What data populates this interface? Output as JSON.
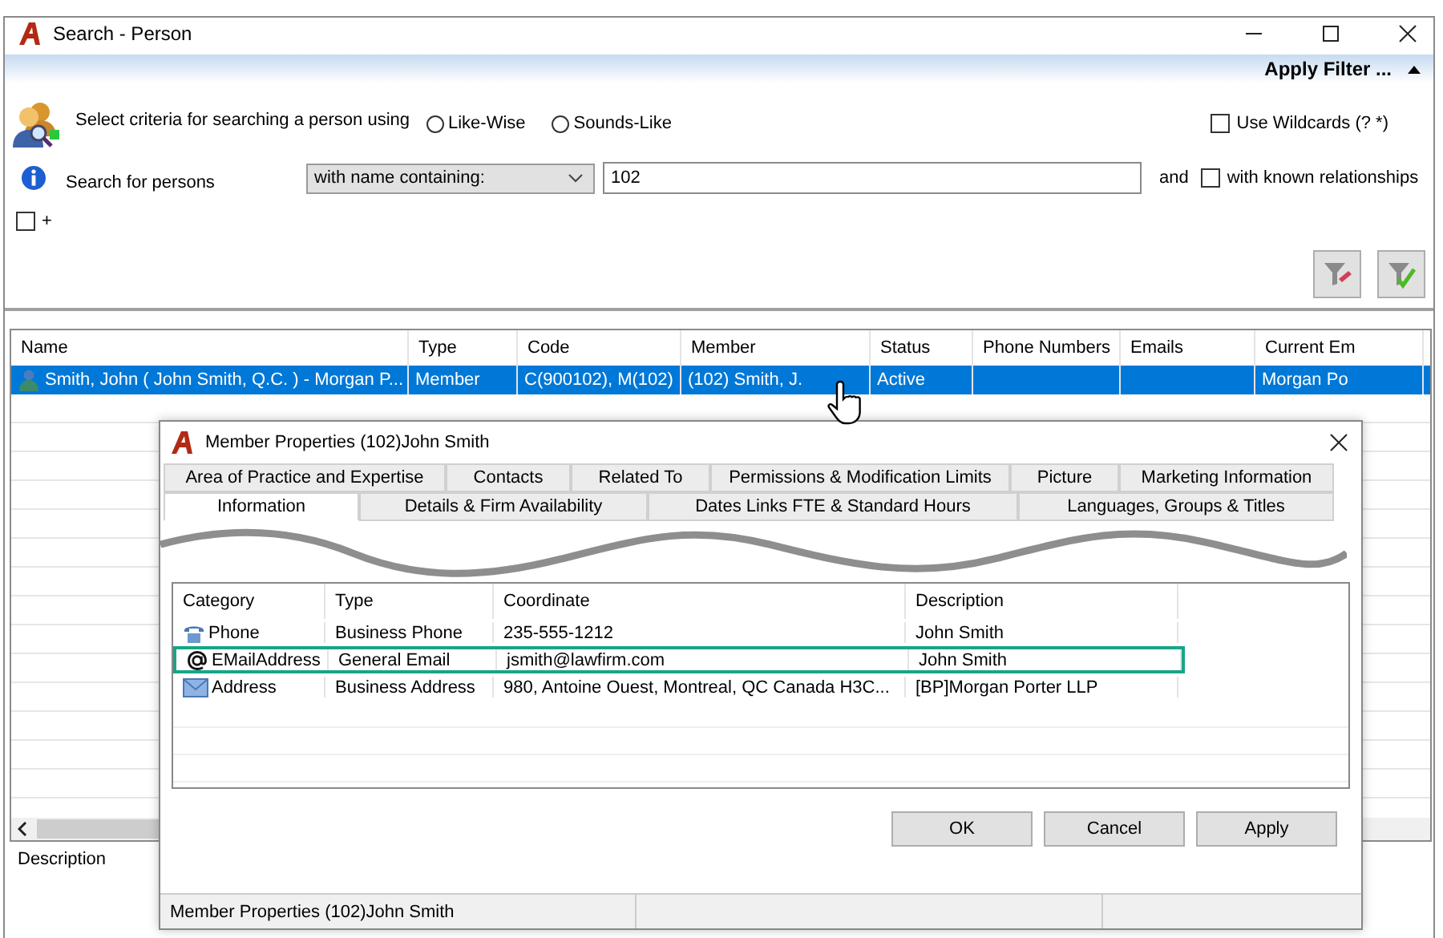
{
  "window": {
    "title": "Search - Person"
  },
  "filter_bar": {
    "title": "Apply Filter ...",
    "expanded": true
  },
  "criteria": {
    "prompt": "Select criteria for searching a person using",
    "match_modes": [
      {
        "label": "Like-Wise",
        "selected": false
      },
      {
        "label": "Sounds-Like",
        "selected": false
      }
    ],
    "use_wildcards": {
      "label": "Use Wildcards (? *)",
      "checked": false
    },
    "search_label": "Search for persons",
    "condition": "with name containing:",
    "value": "102",
    "and_label": "and",
    "known_relationships": {
      "label": "with known relationships",
      "checked": false
    },
    "plus": {
      "label": "+",
      "checked": false
    }
  },
  "results": {
    "columns": [
      "Name",
      "Type",
      "Code",
      "Member",
      "Status",
      "Phone Numbers",
      "Emails",
      "Current Em"
    ],
    "rows": [
      {
        "selected": true,
        "cells": [
          "Smith, John ( John Smith, Q.C. ) - Morgan P...",
          "Member",
          "C(900102), M(102)",
          "(102) Smith, J.",
          "Active",
          null,
          null,
          "Morgan Po"
        ]
      }
    ]
  },
  "description_label": "Description",
  "dialog": {
    "title": "Member Properties  (102)John Smith",
    "tab_rows": [
      [
        {
          "label": "Area of Practice and Expertise",
          "selected": false
        },
        {
          "label": "Contacts",
          "selected": false
        },
        {
          "label": "Related To",
          "selected": false
        },
        {
          "label": "Permissions & Modification Limits",
          "selected": false
        },
        {
          "label": "Picture",
          "selected": false
        },
        {
          "label": "Marketing Information",
          "selected": false
        }
      ],
      [
        {
          "label": "Information",
          "selected": true
        },
        {
          "label": "Details & Firm Availability",
          "selected": false
        },
        {
          "label": "Dates Links FTE & Standard Hours",
          "selected": false
        },
        {
          "label": "Languages, Groups & Titles",
          "selected": false
        }
      ]
    ],
    "table": {
      "columns": [
        "Category",
        "Type",
        "Coordinate",
        "Description"
      ],
      "rows": [
        {
          "kind": "phone",
          "highlighted": false,
          "cells": [
            "Phone",
            "Business Phone",
            "235-555-1212",
            "John Smith"
          ]
        },
        {
          "kind": "email",
          "highlighted": true,
          "cells": [
            "EMailAddress",
            "General Email",
            "jsmith@lawfirm.com",
            "John Smith"
          ]
        },
        {
          "kind": "address",
          "highlighted": false,
          "cells": [
            "Address",
            "Business Address",
            "980, Antoine Ouest, Montreal, QC Canada H3C...",
            "[BP]Morgan Porter LLP"
          ]
        }
      ]
    },
    "buttons": [
      "OK",
      "Cancel",
      "Apply"
    ],
    "status_bar": "Member Properties  (102)John Smith"
  }
}
